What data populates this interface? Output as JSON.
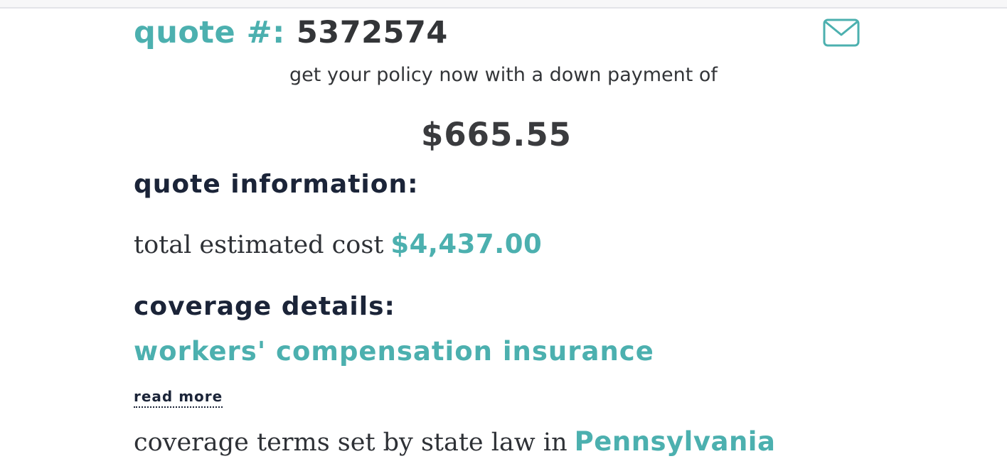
{
  "quote": {
    "label": "quote #:",
    "number": "5372574",
    "email_icon": "envelope-icon"
  },
  "down_payment": {
    "text": "get your policy now with a down payment of",
    "amount": "$665.55"
  },
  "quote_information": {
    "heading": "quote information:",
    "total_cost_label": "total estimated cost",
    "total_cost_value": "$4,437.00"
  },
  "coverage": {
    "heading": "coverage details:",
    "name": "workers' compensation insurance",
    "read_more": "read more",
    "terms_label": "coverage terms set by state law in",
    "state": "Pennsylvania"
  },
  "colors": {
    "accent": "#4cb0af",
    "heading": "#1b2438",
    "text": "#333538"
  }
}
